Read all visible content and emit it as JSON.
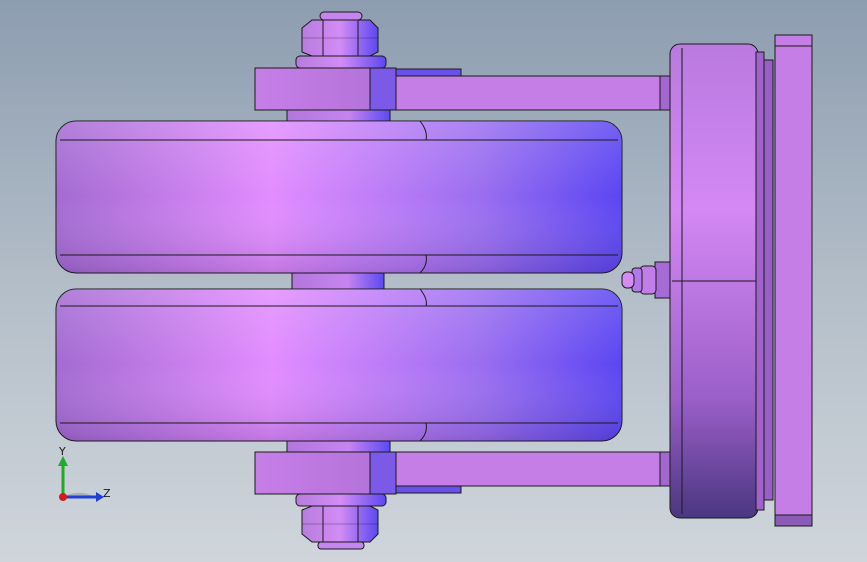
{
  "viewport": {
    "background_top": "#8d9db0",
    "background_bottom": "#cfd5db"
  },
  "model": {
    "color_light": "#e28cff",
    "color_mid": "#b374d8",
    "color_dark": "#6a4fe0",
    "edge_color": "#1a1a1a",
    "parts": [
      "top-nut",
      "bottom-nut",
      "top-bracket-plate",
      "bottom-bracket-plate",
      "upper-wheel",
      "lower-wheel",
      "axle-hub",
      "mounting-flange",
      "base-plate",
      "grease-fitting"
    ]
  },
  "triad": {
    "y_label": "Y",
    "z_label": "Z",
    "y_color": "#1faa2a",
    "z_color": "#1f3fd8",
    "x_color": "#d41c1c"
  }
}
